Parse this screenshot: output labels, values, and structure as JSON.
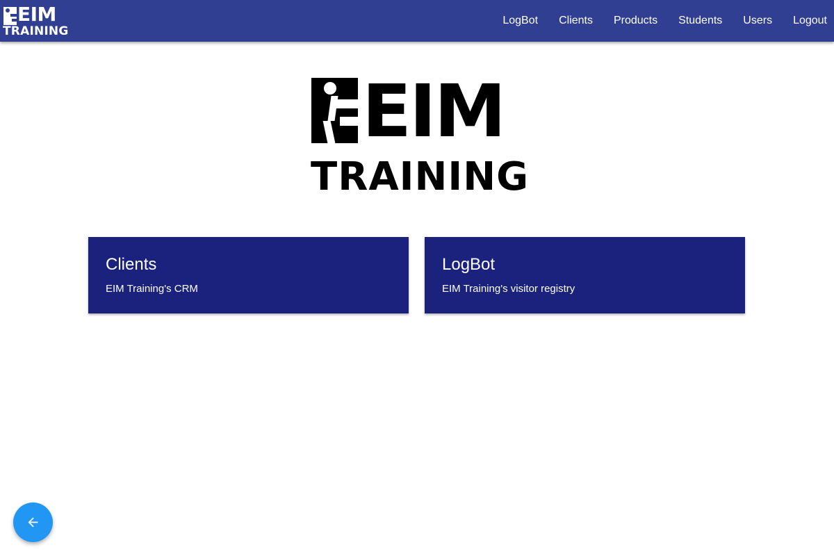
{
  "navbar": {
    "logo": {
      "top": "EIM",
      "bottom": "TRAINING"
    },
    "links": [
      "LogBot",
      "Clients",
      "Products",
      "Students",
      "Users",
      "Logout"
    ]
  },
  "hero": {
    "logo": {
      "top": "EIM",
      "bottom": "TRAINING"
    }
  },
  "cards": [
    {
      "title": "Clients",
      "subtitle": "EIM Training's CRM"
    },
    {
      "title": "LogBot",
      "subtitle": "EIM Training's visitor registry"
    }
  ],
  "fab": {
    "icon": "arrow-left-icon"
  },
  "colors": {
    "navbar": "#303f92",
    "card": "#1a227e",
    "fab": "#2196f3"
  }
}
